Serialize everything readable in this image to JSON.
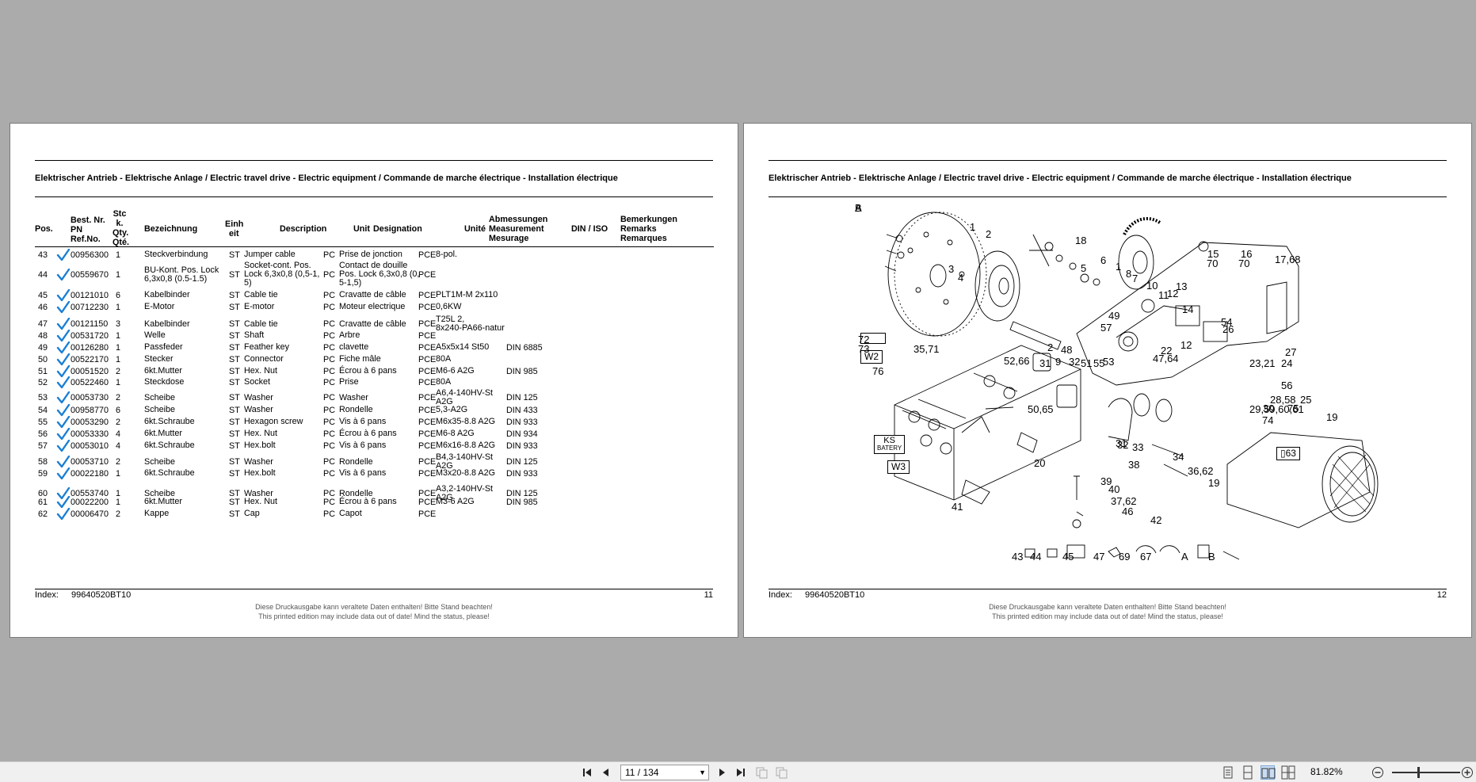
{
  "document": {
    "header_title": "Elektrischer Antrieb - Elektrische Anlage / Electric travel drive - Electric equipment / Commande de marche électrique - Installation électrique",
    "index_label": "Index:",
    "index_value": "99640520BT10",
    "disclaimer_de": "Diese Druckausgabe kann veraltete Daten enthalten! Bitte Stand beachten!",
    "disclaimer_en": "This printed edition may include data out of date! Mind the status, please!"
  },
  "left_page": {
    "page_number": "11",
    "columns": {
      "pos": "Pos.",
      "part_no": [
        "Best. Nr.",
        "PN",
        "Ref.No."
      ],
      "qty": [
        "Stc",
        "k.",
        "Qty.",
        "Qté."
      ],
      "bezeichnung": "Bezeichnung",
      "einheit": [
        "Einh",
        "eit"
      ],
      "description": "Description",
      "unit": "Unit",
      "designation": "Designation",
      "unite": "Unité",
      "dimensions": [
        "Abmessungen",
        "Measurement",
        "Mesurage"
      ],
      "din": "DIN / ISO",
      "remarks": [
        "Bemerkungen",
        "Remarks",
        "Remarques"
      ]
    },
    "rows": [
      {
        "pos": "43",
        "pn": "00956300",
        "qty": "1",
        "de": [
          "Steckverbindung"
        ],
        "eh": "ST",
        "en": [
          "Jumper cable"
        ],
        "unit": "PC",
        "fr": [
          "Prise de jonction"
        ],
        "unite": "PCE",
        "dim": [
          "8-pol."
        ],
        "din": ""
      },
      {
        "pos": "44",
        "pn": "00559670",
        "qty": "1",
        "de": [
          "BU-Kont. Pos. Lock",
          "6,3x0,8  (0.5-1.5)"
        ],
        "eh": "ST",
        "en": [
          "Socket-cont. Pos.",
          "Lock 6,3x0,8 (0,5-1,",
          "5)"
        ],
        "unit": "PC",
        "fr": [
          "Contact de douille",
          "Pos. Lock 6,3x0,8 (0,",
          "5-1,5)"
        ],
        "unite": "PCE",
        "dim": [
          ""
        ],
        "din": ""
      },
      {
        "pos": "45",
        "pn": "00121010",
        "qty": "6",
        "de": [
          "Kabelbinder"
        ],
        "eh": "ST",
        "en": [
          "Cable tie"
        ],
        "unit": "PC",
        "fr": [
          "Cravatte de câble"
        ],
        "unite": "PCE",
        "dim": [
          "PLT1M-M 2x110"
        ],
        "din": ""
      },
      {
        "pos": "46",
        "pn": "00712230",
        "qty": "1",
        "de": [
          "E-Motor"
        ],
        "eh": "ST",
        "en": [
          "E-motor"
        ],
        "unit": "PC",
        "fr": [
          "Moteur electrique"
        ],
        "unite": "PCE",
        "dim": [
          "0,6KW"
        ],
        "din": ""
      },
      {
        "pos": "47",
        "pn": "00121150",
        "qty": "3",
        "de": [
          "Kabelbinder"
        ],
        "eh": "ST",
        "en": [
          "Cable tie"
        ],
        "unit": "PC",
        "fr": [
          "Cravatte de câble"
        ],
        "unite": "PCE",
        "dim": [
          "T25L 2,",
          "8x240-PA66-natur"
        ],
        "din": ""
      },
      {
        "pos": "48",
        "pn": "00531720",
        "qty": "1",
        "de": [
          "Welle"
        ],
        "eh": "ST",
        "en": [
          "Shaft"
        ],
        "unit": "PC",
        "fr": [
          "Arbre"
        ],
        "unite": "PCE",
        "dim": [
          ""
        ],
        "din": ""
      },
      {
        "pos": "49",
        "pn": "00126280",
        "qty": "1",
        "de": [
          "Passfeder"
        ],
        "eh": "ST",
        "en": [
          "Feather key"
        ],
        "unit": "PC",
        "fr": [
          "clavette"
        ],
        "unite": "PCE",
        "dim": [
          "A5x5x14 St50"
        ],
        "din": "DIN 6885"
      },
      {
        "pos": "50",
        "pn": "00522170",
        "qty": "1",
        "de": [
          "Stecker"
        ],
        "eh": "ST",
        "en": [
          "Connector"
        ],
        "unit": "PC",
        "fr": [
          "Fiche mâle"
        ],
        "unite": "PCE",
        "dim": [
          "80A"
        ],
        "din": ""
      },
      {
        "pos": "51",
        "pn": "00051520",
        "qty": "2",
        "de": [
          "6kt.Mutter"
        ],
        "eh": "ST",
        "en": [
          "Hex. Nut"
        ],
        "unit": "PC",
        "fr": [
          "Écrou à 6 pans"
        ],
        "unite": "PCE",
        "dim": [
          "M6-6 A2G"
        ],
        "din": "DIN 985"
      },
      {
        "pos": "52",
        "pn": "00522460",
        "qty": "1",
        "de": [
          "Steckdose"
        ],
        "eh": "ST",
        "en": [
          "Socket"
        ],
        "unit": "PC",
        "fr": [
          "Prise"
        ],
        "unite": "PCE",
        "dim": [
          "80A"
        ],
        "din": ""
      },
      {
        "pos": "53",
        "pn": "00053730",
        "qty": "2",
        "de": [
          "Scheibe"
        ],
        "eh": "ST",
        "en": [
          "Washer"
        ],
        "unit": "PC",
        "fr": [
          "Washer"
        ],
        "unite": "PCE",
        "dim": [
          "A6,4-140HV-St",
          "A2G"
        ],
        "din": "DIN 125"
      },
      {
        "pos": "54",
        "pn": "00958770",
        "qty": "6",
        "de": [
          "Scheibe"
        ],
        "eh": "ST",
        "en": [
          "Washer"
        ],
        "unit": "PC",
        "fr": [
          "Rondelle"
        ],
        "unite": "PCE",
        "dim": [
          "5,3-A2G"
        ],
        "din": "DIN 433"
      },
      {
        "pos": "55",
        "pn": "00053290",
        "qty": "2",
        "de": [
          "6kt.Schraube"
        ],
        "eh": "ST",
        "en": [
          "Hexagon screw"
        ],
        "unit": "PC",
        "fr": [
          "Vis à 6 pans"
        ],
        "unite": "PCE",
        "dim": [
          "M6x35-8.8 A2G"
        ],
        "din": "DIN 933"
      },
      {
        "pos": "56",
        "pn": "00053330",
        "qty": "4",
        "de": [
          "6kt.Mutter"
        ],
        "eh": "ST",
        "en": [
          "Hex. Nut"
        ],
        "unit": "PC",
        "fr": [
          "Écrou à 6 pans"
        ],
        "unite": "PCE",
        "dim": [
          "M6-8 A2G"
        ],
        "din": "DIN 934"
      },
      {
        "pos": "57",
        "pn": "00053010",
        "qty": "4",
        "de": [
          "6kt.Schraube"
        ],
        "eh": "ST",
        "en": [
          "Hex.bolt"
        ],
        "unit": "PC",
        "fr": [
          "Vis à 6 pans"
        ],
        "unite": "PCE",
        "dim": [
          "M6x16-8.8 A2G"
        ],
        "din": "DIN 933"
      },
      {
        "pos": "58",
        "pn": "00053710",
        "qty": "2",
        "de": [
          "Scheibe"
        ],
        "eh": "ST",
        "en": [
          "Washer"
        ],
        "unit": "PC",
        "fr": [
          "Rondelle"
        ],
        "unite": "PCE",
        "dim": [
          "B4,3-140HV-St",
          "A2G"
        ],
        "din": "DIN 125"
      },
      {
        "pos": "59",
        "pn": "00022180",
        "qty": "1",
        "de": [
          "6kt.Schraube"
        ],
        "eh": "ST",
        "en": [
          "Hex.bolt"
        ],
        "unit": "PC",
        "fr": [
          "Vis à 6 pans"
        ],
        "unite": "PCE",
        "dim": [
          "M3x20-8.8 A2G"
        ],
        "din": "DIN 933"
      },
      {
        "pos": "60",
        "pn": "00553740",
        "qty": "1",
        "de": [
          "Scheibe"
        ],
        "eh": "ST",
        "en": [
          "Washer"
        ],
        "unit": "PC",
        "fr": [
          "Rondelle"
        ],
        "unite": "PCE",
        "dim": [
          "A3,2-140HV-St",
          "A2G"
        ],
        "din": "DIN 125"
      },
      {
        "pos": "61",
        "pn": "00022200",
        "qty": "1",
        "de": [
          "6kt.Mutter"
        ],
        "eh": "ST",
        "en": [
          "Hex. Nut"
        ],
        "unit": "PC",
        "fr": [
          "Écrou à 6 pans"
        ],
        "unite": "PCE",
        "dim": [
          "M3-6 A2G"
        ],
        "din": "DIN 985"
      },
      {
        "pos": "62",
        "pn": "00006470",
        "qty": "2",
        "de": [
          "Kappe"
        ],
        "eh": "ST",
        "en": [
          "Cap"
        ],
        "unit": "PC",
        "fr": [
          "Capot"
        ],
        "unite": "PCE",
        "dim": [
          ""
        ],
        "din": ""
      }
    ]
  },
  "right_page": {
    "page_number": "12",
    "diagram_boxes": {
      "w2": "W2",
      "w3": "W3",
      "ks": "KS",
      "batery": "BATERY",
      "box63": "63"
    },
    "callouts": [
      "1",
      "2",
      "3",
      "4",
      "18",
      "5",
      "6",
      "1",
      "8",
      "7",
      "10",
      "11",
      "12",
      "13",
      "14",
      "15",
      "70",
      "16",
      "70",
      "17,68",
      "49",
      "57",
      "48",
      "32",
      "2",
      "31",
      "55",
      "53",
      "51",
      "47,64",
      "22",
      "12",
      "26",
      "54",
      "27",
      "24",
      "23,21",
      "56",
      "25",
      "28,58",
      "29,59,60,61",
      "30",
      "75",
      "74",
      "19",
      "72",
      "73",
      "76",
      "35,71",
      "52,66",
      "50,65",
      "9",
      "31",
      "32",
      "33",
      "34",
      "36,62",
      "19",
      "20",
      "38",
      "39",
      "40",
      "37,62",
      "46",
      "41",
      "42",
      "43",
      "44",
      "45",
      "47",
      "69",
      "67",
      "A",
      "B",
      "A",
      "B"
    ]
  },
  "toolbar": {
    "page_field": "11 / 134",
    "zoom": "81.82%"
  },
  "colors": {
    "background": "#ababab",
    "page": "#ffffff",
    "checkmark": "#1a7fd4",
    "toolbar": "#f0f0f0"
  }
}
